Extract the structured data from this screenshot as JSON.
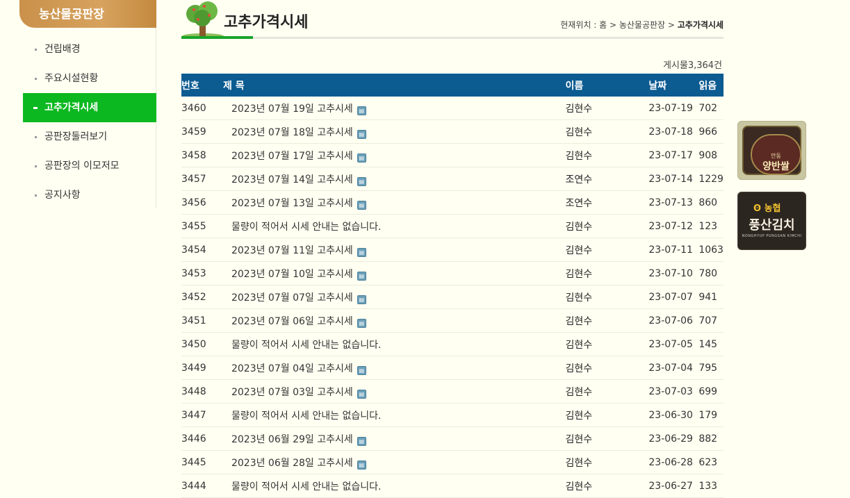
{
  "sidebar": {
    "title": "농산물공판장",
    "items": [
      {
        "label": "건립배경"
      },
      {
        "label": "주요시설현황"
      },
      {
        "label": "고추가격시세"
      },
      {
        "label": "공판장둘러보기"
      },
      {
        "label": "공판장의 이모저모"
      },
      {
        "label": "공지사항"
      }
    ],
    "active_index": 2
  },
  "header": {
    "title": "고추가격시세",
    "breadcrumb_prefix": "현재위치 : 홈 > 농산물공판장 > ",
    "breadcrumb_current": "고추가격시세"
  },
  "board": {
    "count_label": "게시물3,364건",
    "columns": {
      "num": "번호",
      "title": "제 목",
      "name": "이름",
      "date": "날짜",
      "read": "읽음"
    },
    "rows": [
      {
        "num": "3460",
        "title": "2023년 07월 19일 고추시세",
        "attach": true,
        "name": "김현수",
        "date": "23-07-19",
        "read": "702"
      },
      {
        "num": "3459",
        "title": "2023년 07월 18일 고추시세",
        "attach": true,
        "name": "김현수",
        "date": "23-07-18",
        "read": "966"
      },
      {
        "num": "3458",
        "title": "2023년 07월 17일 고추시세",
        "attach": true,
        "name": "김현수",
        "date": "23-07-17",
        "read": "908"
      },
      {
        "num": "3457",
        "title": "2023년 07월 14일 고추시세",
        "attach": true,
        "name": "조연수",
        "date": "23-07-14",
        "read": "1229"
      },
      {
        "num": "3456",
        "title": "2023년 07월 13일 고추시세",
        "attach": true,
        "name": "조연수",
        "date": "23-07-13",
        "read": "860"
      },
      {
        "num": "3455",
        "title": "물량이 적어서 시세 안내는 없습니다.",
        "attach": false,
        "name": "김현수",
        "date": "23-07-12",
        "read": "123"
      },
      {
        "num": "3454",
        "title": "2023년 07월 11일 고추시세",
        "attach": true,
        "name": "김현수",
        "date": "23-07-11",
        "read": "1063"
      },
      {
        "num": "3453",
        "title": "2023년 07월 10일 고추시세",
        "attach": true,
        "name": "김현수",
        "date": "23-07-10",
        "read": "780"
      },
      {
        "num": "3452",
        "title": "2023년 07월 07일 고추시세",
        "attach": true,
        "name": "김현수",
        "date": "23-07-07",
        "read": "941"
      },
      {
        "num": "3451",
        "title": "2023년 07월 06일 고추시세",
        "attach": true,
        "name": "김현수",
        "date": "23-07-06",
        "read": "707"
      },
      {
        "num": "3450",
        "title": "물량이 적어서 시세 안내는 없습니다.",
        "attach": false,
        "name": "김현수",
        "date": "23-07-05",
        "read": "145"
      },
      {
        "num": "3449",
        "title": "2023년 07월 04일 고추시세",
        "attach": true,
        "name": "김현수",
        "date": "23-07-04",
        "read": "795"
      },
      {
        "num": "3448",
        "title": "2023년 07월 03일 고추시세",
        "attach": true,
        "name": "김현수",
        "date": "23-07-03",
        "read": "699"
      },
      {
        "num": "3447",
        "title": "물량이 적어서 시세 안내는 없습니다.",
        "attach": false,
        "name": "김현수",
        "date": "23-06-30",
        "read": "179"
      },
      {
        "num": "3446",
        "title": "2023년 06월 29일 고추시세",
        "attach": true,
        "name": "김현수",
        "date": "23-06-29",
        "read": "882"
      },
      {
        "num": "3445",
        "title": "2023년 06월 28일 고추시세",
        "attach": true,
        "name": "김현수",
        "date": "23-06-28",
        "read": "623"
      },
      {
        "num": "3444",
        "title": "물량이 적어서 시세 안내는 없습니다.",
        "attach": false,
        "name": "김현수",
        "date": "23-06-27",
        "read": "133"
      }
    ]
  },
  "banners": {
    "rice": {
      "small": "안동",
      "name": "양반쌀"
    },
    "kimchi": {
      "logo": "농협",
      "name": "풍산김치",
      "sub": "NONGHYUP PUNGSAN KIMCHI"
    }
  },
  "colors": {
    "accent_green": "#0cb820",
    "table_header": "#0c5b91",
    "sidebar_title": "#c9914a",
    "background": "#fffff2"
  }
}
